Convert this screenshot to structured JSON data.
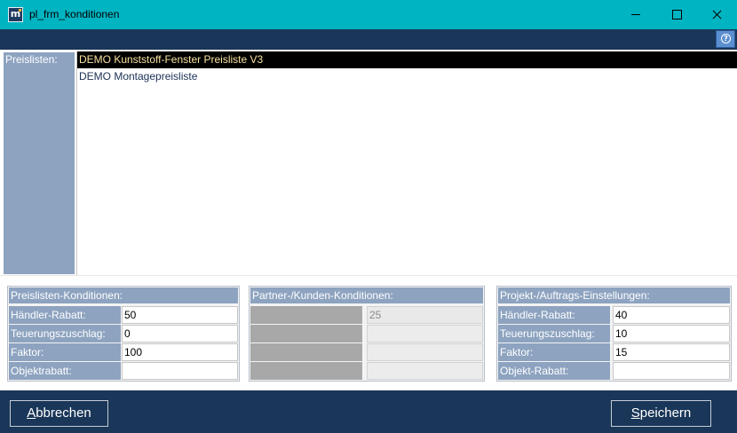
{
  "window": {
    "title": "pl_frm_konditionen",
    "app_icon_letter": "m"
  },
  "toolbar": {
    "help_glyph": "?"
  },
  "price_lists": {
    "label": "Preislisten:",
    "items": [
      {
        "label": "DEMO Kunststoff-Fenster Preisliste V3",
        "selected": true
      },
      {
        "label": "DEMO Montagepreisliste",
        "selected": false
      }
    ]
  },
  "panels": {
    "preislisten": {
      "title": "Preislisten-Konditionen:",
      "rows": [
        {
          "label": "Händler-Rabatt:",
          "value": "50"
        },
        {
          "label": "Teuerungszuschlag:",
          "value": "0"
        },
        {
          "label": "Faktor:",
          "value": "100"
        },
        {
          "label": "Objektrabatt:",
          "value": ""
        }
      ]
    },
    "partner": {
      "title": "Partner-/Kunden-Konditionen:",
      "rows": [
        {
          "label": "",
          "value": "25"
        },
        {
          "label": "",
          "value": ""
        },
        {
          "label": "",
          "value": ""
        },
        {
          "label": "",
          "value": ""
        }
      ]
    },
    "projekt": {
      "title": "Projekt-/Auftrags-Einstellungen:",
      "rows": [
        {
          "label": "Händler-Rabatt:",
          "value": "40"
        },
        {
          "label": "Teuerungszuschlag:",
          "value": "10"
        },
        {
          "label": "Faktor:",
          "value": "15"
        },
        {
          "label": "Objekt-Rabatt:",
          "value": ""
        }
      ]
    }
  },
  "footer": {
    "cancel": {
      "mnemonic": "A",
      "rest": "bbrechen"
    },
    "save": {
      "mnemonic": "S",
      "rest": "peichern"
    }
  },
  "colors": {
    "titlebar": "#00b4c2",
    "navy": "#1a3658",
    "label_bg": "#8da3c0",
    "selection_bg": "#000000",
    "selection_text": "#f7e1a0"
  },
  "icons": [
    "app-logo-icon",
    "minimize-icon",
    "maximize-icon",
    "close-icon",
    "help-icon"
  ]
}
